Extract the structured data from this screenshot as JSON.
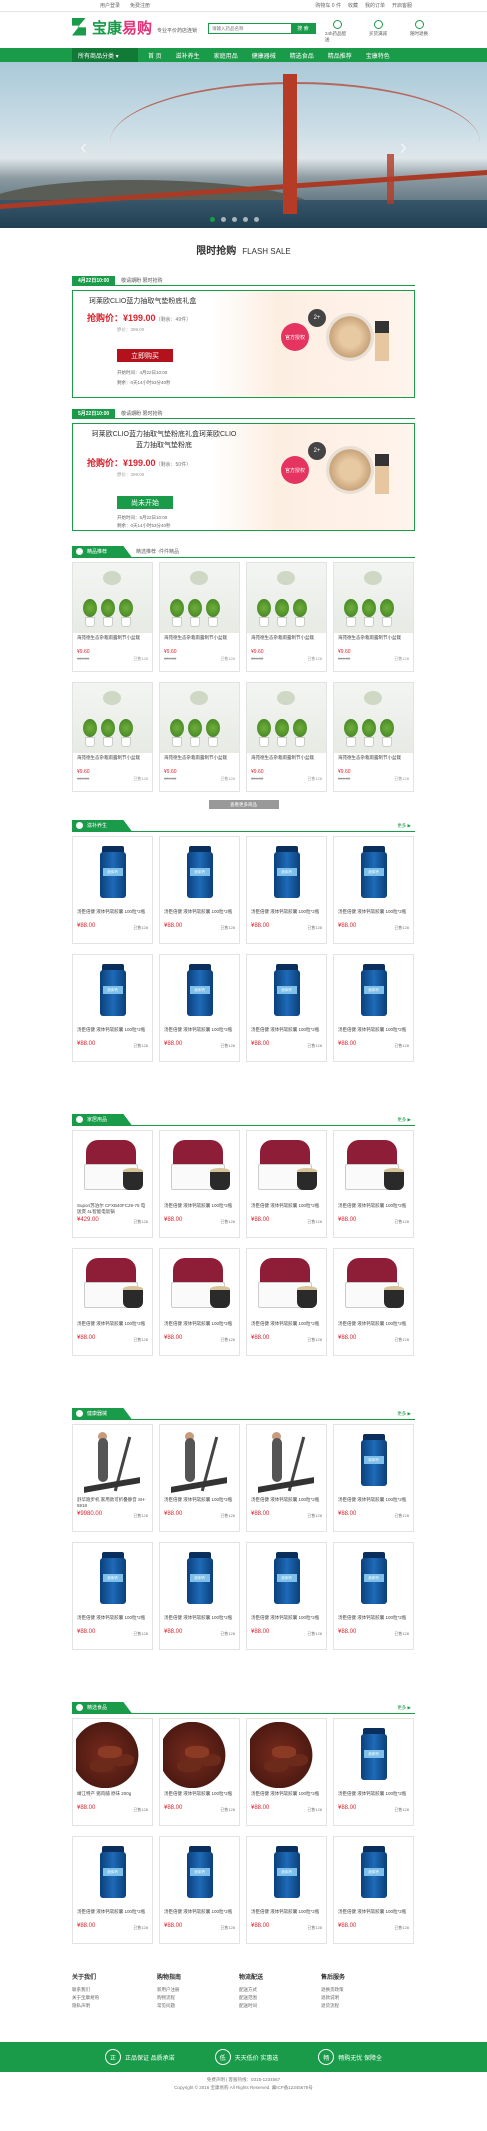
{
  "topbar": {
    "left": [
      "用户登录",
      "免费注册"
    ],
    "right": [
      "购物车 0 件",
      "收藏",
      "我的订单",
      "开启客服"
    ]
  },
  "header": {
    "logo_a": "宝康",
    "logo_b": "易购",
    "slogan": "专业平价药店连锁",
    "search_placeholder": "请输入药品名称",
    "search_button": "搜 索",
    "icons": [
      "24h药品配送",
      "买货满减",
      "随时退换"
    ]
  },
  "nav": {
    "all": "所有商品分类 ▾",
    "items": [
      "首 页",
      "滋补养生",
      "家庭用品",
      "健康器械",
      "精选食品",
      "精品推荐",
      "宝康特色"
    ]
  },
  "flash": {
    "title": "限时抢购",
    "title_en": "FLASH SALE",
    "items": [
      {
        "date": "4月22日10:00",
        "note": "敬请期盼 限时抢购",
        "name": "珂莱欧CLIO蓝力抽取气垫粉底礼盒",
        "price_label": "抢购价：¥199.00",
        "limit": "（剩余：49件）",
        "old": "原价：399.00",
        "button": "立即购买",
        "start": "开始时间：4月22日10:00",
        "remain": "剩余：0天14小时53分40秒",
        "badge": "官方授权",
        "pill": "2+"
      },
      {
        "date": "5月22日10:00",
        "note": "敬请期盼 限时抢购",
        "name": "珂莱欧CLIO蓝力抽取气垫粉底礼盒珂莱欧CLIO蓝力抽取气垫粉底",
        "price_label": "抢购价：¥199.00",
        "limit": "（剩余：50件）",
        "old": "原价：399.00",
        "button": "尚未开始",
        "start": "开始时间：5月22日10:00",
        "remain": "剩余：0天14小时53分40秒",
        "badge": "官方授权",
        "pill": "2+"
      }
    ]
  },
  "recommend": {
    "label": "精品推荐",
    "sub": "精选推荐 ·件件精品",
    "product_name": "海苑德生态杂栽雨露制节小盆栽",
    "price": "¥9.60",
    "old": "¥24.00",
    "sales": "已售128",
    "more": "查看更多商品"
  },
  "floors": [
    {
      "label": "滋补养生",
      "more": "更多 ▶",
      "items": [
        {
          "name": "汤臣倍健 液体钙软胶囊 100粒*2瓶",
          "price": "¥88.00",
          "rv": "已售128"
        },
        {
          "name": "汤臣倍健 液体钙软胶囊 100粒*2瓶",
          "price": "¥88.00",
          "rv": "已售128"
        },
        {
          "name": "汤臣倍健 液体钙软胶囊 100粒*2瓶",
          "price": "¥88.00",
          "rv": "已售128"
        },
        {
          "name": "汤臣倍健 液体钙软胶囊 100粒*2瓶",
          "price": "¥88.00",
          "rv": "已售128"
        },
        {
          "name": "汤臣倍健 液体钙软胶囊 100粒*2瓶",
          "price": "¥88.00",
          "rv": "已售128"
        },
        {
          "name": "汤臣倍健 液体钙软胶囊 100粒*2瓶",
          "price": "¥88.00",
          "rv": "已售128"
        },
        {
          "name": "汤臣倍健 液体钙软胶囊 100粒*2瓶",
          "price": "¥88.00",
          "rv": "已售128"
        },
        {
          "name": "汤臣倍健 液体钙软胶囊 100粒*2瓶",
          "price": "¥88.00",
          "rv": "已售128"
        }
      ]
    },
    {
      "label": "家居用品",
      "more": "更多 ▶",
      "items": [
        {
          "name": "Supor/苏泊尔 CFXB40FC29-75 电饭煲 4L智能电饭锅",
          "price": "¥429.00",
          "rv": "已售128"
        },
        {
          "name": "汤臣倍健 液体钙软胶囊 100粒*2瓶",
          "price": "¥88.00",
          "rv": "已售128"
        },
        {
          "name": "汤臣倍健 液体钙软胶囊 100粒*2瓶",
          "price": "¥88.00",
          "rv": "已售128"
        },
        {
          "name": "汤臣倍健 液体钙软胶囊 100粒*2瓶",
          "price": "¥88.00",
          "rv": "已售128"
        },
        {
          "name": "汤臣倍健 液体钙软胶囊 100粒*2瓶",
          "price": "¥88.00",
          "rv": "已售128"
        },
        {
          "name": "汤臣倍健 液体钙软胶囊 100粒*2瓶",
          "price": "¥88.00",
          "rv": "已售128"
        },
        {
          "name": "汤臣倍健 液体钙软胶囊 100粒*2瓶",
          "price": "¥88.00",
          "rv": "已售128"
        },
        {
          "name": "汤臣倍健 液体钙软胶囊 100粒*2瓶",
          "price": "¥88.00",
          "rv": "已售128"
        }
      ]
    },
    {
      "label": "健康器械",
      "more": "更多 ▶",
      "items": [
        {
          "name": "舒华跑步机 家用款可折叠静音 SH-5918",
          "price": "¥9980.00",
          "rv": "已售128"
        },
        {
          "name": "汤臣倍健 液体钙软胶囊 100粒*2瓶",
          "price": "¥88.00",
          "rv": "已售128"
        },
        {
          "name": "汤臣倍健 液体钙软胶囊 100粒*2瓶",
          "price": "¥88.00",
          "rv": "已售128"
        },
        {
          "name": "汤臣倍健 液体钙软胶囊 100粒*2瓶",
          "price": "¥88.00",
          "rv": "已售128"
        },
        {
          "name": "汤臣倍健 液体钙软胶囊 100粒*2瓶",
          "price": "¥88.00",
          "rv": "已售128"
        },
        {
          "name": "汤臣倍健 液体钙软胶囊 100粒*2瓶",
          "price": "¥88.00",
          "rv": "已售128"
        },
        {
          "name": "汤臣倍健 液体钙软胶囊 100粒*2瓶",
          "price": "¥88.00",
          "rv": "已售128"
        },
        {
          "name": "汤臣倍健 液体钙软胶囊 100粒*2瓶",
          "price": "¥88.00",
          "rv": "已售128"
        }
      ]
    },
    {
      "label": "精选食品",
      "more": "更多 ▶",
      "items": [
        {
          "name": "靖江特产 猪肉脯 原味 200g",
          "price": "¥88.00",
          "rv": "已售128"
        },
        {
          "name": "汤臣倍健 液体钙软胶囊 100粒*2瓶",
          "price": "¥88.00",
          "rv": "已售128"
        },
        {
          "name": "汤臣倍健 液体钙软胶囊 100粒*2瓶",
          "price": "¥88.00",
          "rv": "已售128"
        },
        {
          "name": "汤臣倍健 液体钙软胶囊 100粒*2瓶",
          "price": "¥88.00",
          "rv": "已售128"
        },
        {
          "name": "汤臣倍健 液体钙软胶囊 100粒*2瓶",
          "price": "¥88.00",
          "rv": "已售128"
        },
        {
          "name": "汤臣倍健 液体钙软胶囊 100粒*2瓶",
          "price": "¥88.00",
          "rv": "已售128"
        },
        {
          "name": "汤臣倍健 液体钙软胶囊 100粒*2瓶",
          "price": "¥88.00",
          "rv": "已售128"
        },
        {
          "name": "汤臣倍健 液体钙软胶囊 100粒*2瓶",
          "price": "¥88.00",
          "rv": "已售128"
        }
      ]
    }
  ],
  "footer": {
    "cols": [
      {
        "title": "关于我们",
        "items": [
          "联系我们",
          "关于宝康易购",
          "隐私声明"
        ]
      },
      {
        "title": "购物指南",
        "items": [
          "新用户注册",
          "购物流程",
          "常见问题"
        ]
      },
      {
        "title": "物流配送",
        "items": [
          "配送方式",
          "配送范围",
          "配送时间"
        ]
      },
      {
        "title": "售后服务",
        "items": [
          "退换货政策",
          "退款说明",
          "退货流程"
        ]
      }
    ],
    "guarantees": [
      {
        "icon": "正",
        "text": "正品保证 品质承诺"
      },
      {
        "icon": "低",
        "text": "天天低价 实惠选"
      },
      {
        "icon": "畅",
        "text": "畅购无忧 保障全"
      }
    ],
    "line1": "免费声明 | 客服热线：0315-1234567",
    "line2": "Copyright © 2016 宝康易购 All Rights Reserved. 冀ICP备12345678号"
  }
}
